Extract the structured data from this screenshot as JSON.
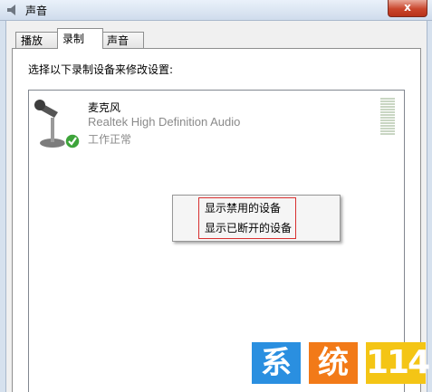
{
  "window": {
    "title": "声音",
    "close_glyph": "x"
  },
  "tabs": [
    {
      "label": "播放",
      "active": false
    },
    {
      "label": "录制",
      "active": true
    },
    {
      "label": "声音",
      "active": false
    }
  ],
  "panel": {
    "instruction": "选择以下录制设备来修改设置:"
  },
  "device": {
    "name": "麦克风",
    "driver": "Realtek High Definition Audio",
    "status": "工作正常",
    "icon": "microphone-icon",
    "status_icon": "green-checkmark-icon"
  },
  "context_menu": {
    "items": [
      {
        "label": "显示禁用的设备"
      },
      {
        "label": "显示已断开的设备"
      }
    ],
    "highlight_color": "#d83030"
  },
  "watermark": {
    "char1": "系",
    "char2": "统",
    "char3": "114"
  },
  "colors": {
    "watermark_blue": "#2a8fe0",
    "watermark_orange": "#f27a18",
    "watermark_yellow": "#f4c515",
    "disabled_text": "#8a8a8a"
  }
}
